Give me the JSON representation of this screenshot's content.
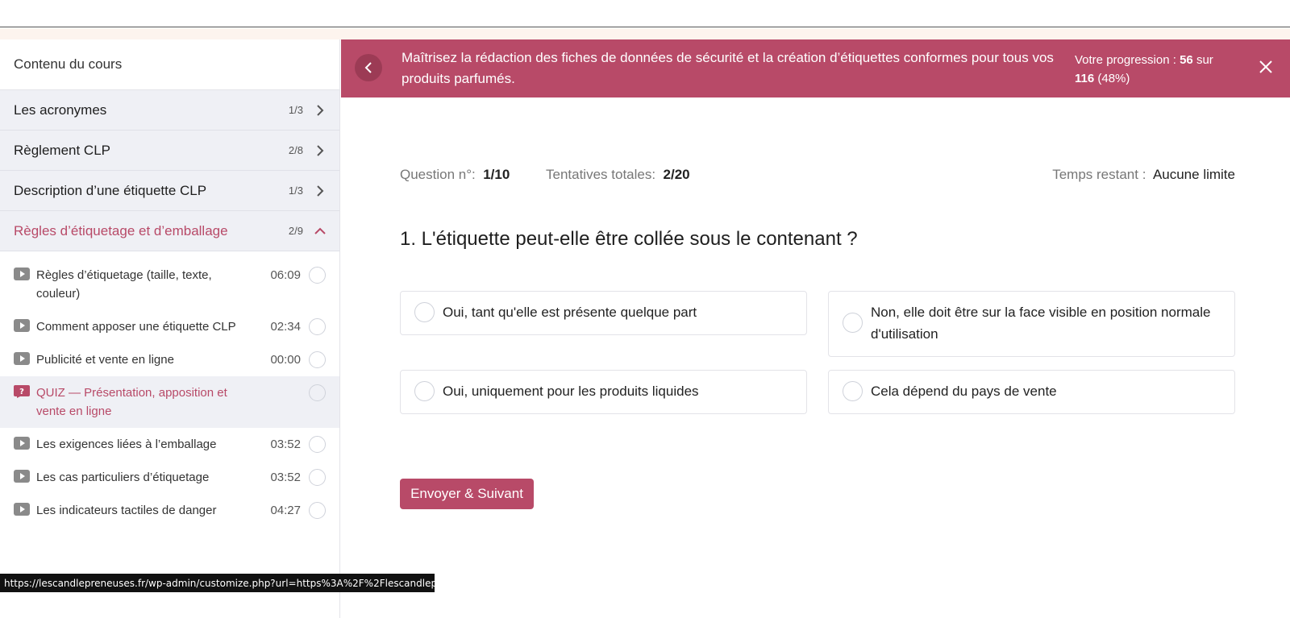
{
  "sidebar": {
    "header": "Contenu du cours",
    "sections": [
      {
        "title": "Les acronymes",
        "count": "1/3"
      },
      {
        "title": "Règlement CLP",
        "count": "2/8"
      },
      {
        "title": "Description d’une étiquette CLP",
        "count": "1/3"
      },
      {
        "title": "Règles d’étiquetage et d’emballage",
        "count": "2/9"
      }
    ],
    "lessons": [
      {
        "title": "Règles d’étiquetage (taille, texte, couleur)",
        "time": "06:09",
        "icon": "video-icon"
      },
      {
        "title": "Comment apposer une étiquette CLP",
        "time": "02:34",
        "icon": "video-icon"
      },
      {
        "title": "Publicité et vente en ligne",
        "time": "00:00",
        "icon": "video-icon"
      },
      {
        "title": "QUIZ — Présentation, apposition et vente en ligne",
        "time": "",
        "icon": "quiz-icon"
      },
      {
        "title": "Les exigences liées à l’emballage",
        "time": "03:52",
        "icon": "video-icon"
      },
      {
        "title": "Les cas particuliers d’étiquetage",
        "time": "03:52",
        "icon": "video-icon"
      },
      {
        "title": "Les indicateurs tactiles de danger",
        "time": "04:27",
        "icon": "video-icon"
      }
    ]
  },
  "banner": {
    "title": "Maîtrisez la rédaction des fiches de données de sécurité et la création d’étiquettes conformes pour tous vos produits parfumés.",
    "progress_label": "Votre progression :",
    "progress_done": "56",
    "progress_sep": "sur",
    "progress_total": "116",
    "progress_pct": "(48%)"
  },
  "quiz": {
    "question_label": "Question n°:",
    "question_value": "1/10",
    "attempts_label": "Tentatives totales:",
    "attempts_value": "2/20",
    "time_label": "Temps restant :",
    "time_value": "Aucune limite",
    "question": "1. L'étiquette peut-elle être collée sous le contenant ?",
    "answers": [
      "Oui, tant qu'elle est présente quelque part",
      "Non, elle doit être sur la face visible en position normale d'utilisation",
      "Oui, uniquement pour les produits liquides",
      "Cela dépend du pays de vente"
    ],
    "submit": "Envoyer & Suivant"
  },
  "status_url": "https://lescandlepreneuses.fr/wp-admin/customize.php?url=https%3A%2F%2Flescandlepren...",
  "colors": {
    "accent": "#b84a68",
    "accent_dark": "#9c3b55",
    "sidebar_bg": "#eff0f5"
  }
}
